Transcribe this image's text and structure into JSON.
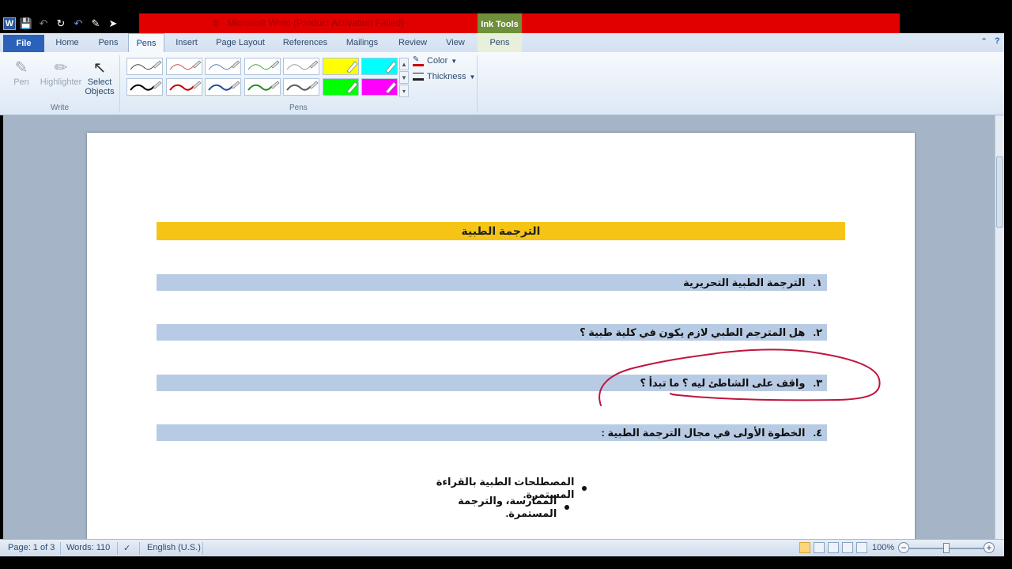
{
  "window": {
    "title": "ft - Microsoft Word (Product Activation Failed)",
    "context_tab_group": "Ink Tools"
  },
  "tabs": [
    {
      "label": "File"
    },
    {
      "label": "Home"
    },
    {
      "label": "Pens"
    },
    {
      "label": "Pens",
      "active": true
    },
    {
      "label": "Insert"
    },
    {
      "label": "Page Layout"
    },
    {
      "label": "References"
    },
    {
      "label": "Mailings"
    },
    {
      "label": "Review"
    },
    {
      "label": "View"
    },
    {
      "label": "Pens"
    }
  ],
  "ribbon": {
    "write_group": {
      "label": "Write",
      "pen": "Pen",
      "highlighter": "Highlighter",
      "select_line1": "Select",
      "select_line2": "Objects"
    },
    "pens_group": {
      "label": "Pens",
      "swatches": [
        {
          "color": "#444444",
          "kind": "pen"
        },
        {
          "color": "#c0504d",
          "kind": "pen"
        },
        {
          "color": "#4f81bd",
          "kind": "pen"
        },
        {
          "color": "#4aa04a",
          "kind": "pen"
        },
        {
          "color": "#9a9a9a",
          "kind": "pen"
        },
        {
          "color": "#ffff00",
          "kind": "highlighter"
        },
        {
          "color": "#00ffff",
          "kind": "highlighter"
        },
        {
          "color": "#000000",
          "kind": "pen"
        },
        {
          "color": "#c00000",
          "kind": "pen"
        },
        {
          "color": "#1f4e9c",
          "kind": "pen"
        },
        {
          "color": "#2a8a2a",
          "kind": "pen"
        },
        {
          "color": "#595959",
          "kind": "pen"
        },
        {
          "color": "#00ff00",
          "kind": "highlighter"
        },
        {
          "color": "#ff00ff",
          "kind": "highlighter"
        }
      ],
      "color_label": "Color",
      "thickness_label": "Thickness"
    }
  },
  "document": {
    "heading": "الترجمة الطبية",
    "questions": [
      {
        "num": "١.",
        "text": "الترجمة الطبية التحريرية"
      },
      {
        "num": "٢.",
        "text": "هل المترجم الطبي لازم يكون في كلية طبية ؟"
      },
      {
        "num": "٣.",
        "text": "واقف على الشاطئ ليه ؟ ما تبدأ ؟"
      },
      {
        "num": "٤.",
        "text": "الخطوة الأولى في مجال الترجمة الطبية :"
      }
    ],
    "bullets": [
      "المصطلحات الطبية بالقراءة المستمرة.",
      "الممارسة، والترجمة المستمرة."
    ],
    "ink_color": "#c0143c"
  },
  "status": {
    "page": "Page: 1 of 3",
    "words": "Words: 110",
    "language": "English (U.S.)",
    "zoom": "100%",
    "zoom_level": 1.0
  }
}
